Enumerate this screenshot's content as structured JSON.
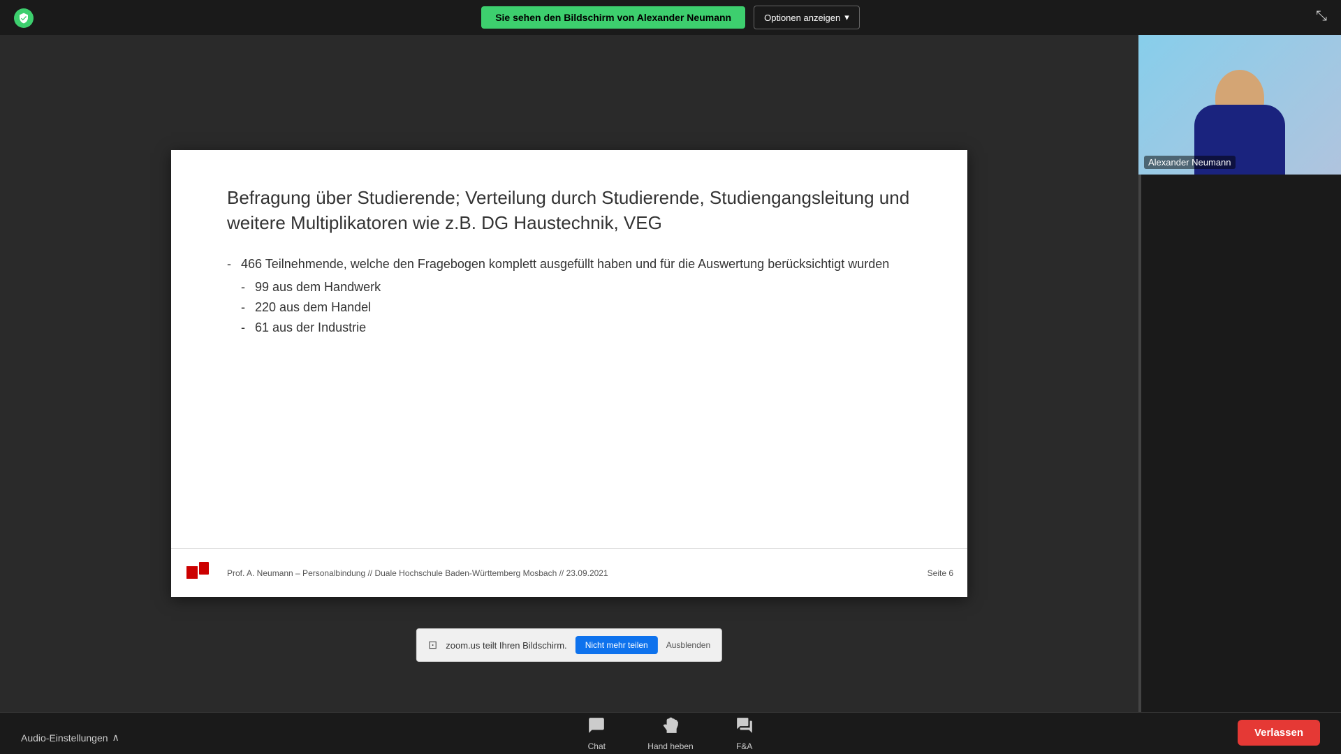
{
  "topbar": {
    "security_icon": "shield",
    "banner_text": "Sie sehen den Bildschirm von Alexander Neumann",
    "options_button": "Optionen anzeigen",
    "collapse_icon": "⤡"
  },
  "slide": {
    "title": "Befragung über Studierende; Verteilung durch Studierende, Studiengangsleitung und weitere Multiplikatoren wie z.B. DG Haustechnik, VEG",
    "main_bullet_text": "466 Teilnehmende, welche den Fragebogen komplett ausgefüllt haben und für die Auswertung berücksichtigt wurden",
    "main_bullet_dash": "-",
    "sub_bullets": [
      {
        "dash": "-",
        "text": "99 aus dem Handwerk"
      },
      {
        "dash": "-",
        "text": "220 aus dem Handel"
      },
      {
        "dash": "-",
        "text": "61 aus der Industrie"
      }
    ],
    "footer_text": "Prof. A. Neumann – Personalbindung // Duale Hochschule Baden-Württemberg Mosbach // 23.09.2021",
    "page_number": "Seite  6"
  },
  "zoom_notification": {
    "text": "zoom.us teilt Ihren Bildschirm.",
    "stop_button": "Nicht mehr teilen",
    "hide_button": "Ausblenden"
  },
  "video": {
    "participant_name": "Alexander Neumann"
  },
  "toolbar": {
    "audio_settings": "Audio-Einstellungen",
    "audio_chevron": "^",
    "chat_label": "Chat",
    "hand_label": "Hand heben",
    "qa_label": "F&A",
    "leave_button": "Verlassen"
  }
}
